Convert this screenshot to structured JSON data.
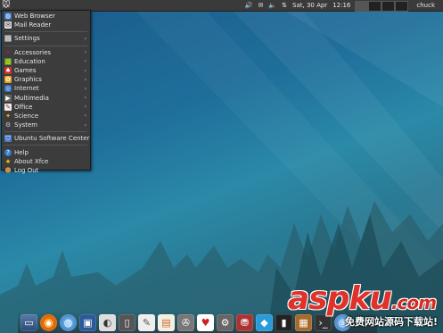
{
  "panel": {
    "clock_date": "Sat, 30 Apr",
    "clock_time": "12:16",
    "user": "chuck",
    "indicators": [
      "volume-icon",
      "mail-icon",
      "speaker-icon",
      "network-icon"
    ]
  },
  "menu": {
    "group1": [
      {
        "label": "Web Browser",
        "icon": "globe-icon"
      },
      {
        "label": "Mail Reader",
        "icon": "mail-icon"
      }
    ],
    "group2": [
      {
        "label": "Settings",
        "icon": "settings-icon",
        "submenu": true
      }
    ],
    "group3": [
      {
        "label": "Accessories",
        "icon": "accessories-icon",
        "submenu": true
      },
      {
        "label": "Education",
        "icon": "education-icon",
        "submenu": true
      },
      {
        "label": "Games",
        "icon": "games-icon",
        "submenu": true
      },
      {
        "label": "Graphics",
        "icon": "graphics-icon",
        "submenu": true
      },
      {
        "label": "Internet",
        "icon": "internet-icon",
        "submenu": true
      },
      {
        "label": "Multimedia",
        "icon": "multimedia-icon",
        "submenu": true
      },
      {
        "label": "Office",
        "icon": "office-icon",
        "submenu": true
      },
      {
        "label": "Science",
        "icon": "science-icon",
        "submenu": true
      },
      {
        "label": "System",
        "icon": "system-icon",
        "submenu": true
      }
    ],
    "group4": [
      {
        "label": "Ubuntu Software Center",
        "icon": "software-center-icon"
      }
    ],
    "group5": [
      {
        "label": "Help",
        "icon": "help-icon"
      },
      {
        "label": "About Xfce",
        "icon": "about-icon"
      },
      {
        "label": "Log Out",
        "icon": "logout-icon"
      }
    ]
  },
  "watermark": {
    "brand": "aspku",
    "tld": ".com",
    "slogan": "免费网站源码下载站!"
  }
}
